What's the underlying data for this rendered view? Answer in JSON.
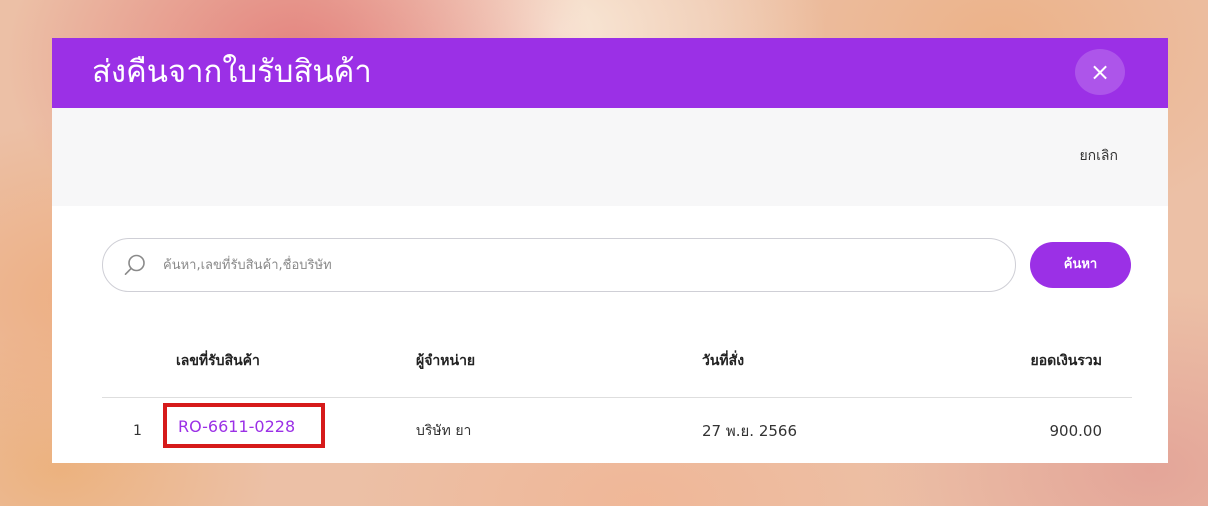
{
  "modal": {
    "title": "ส่งคืนจากใบรับสินค้า",
    "close_icon": "×",
    "cancel_label": "ยกเลิก"
  },
  "search": {
    "placeholder": "ค้นหา,เลขที่รับสินค้า,ชื่อบริษัท",
    "value": "",
    "button_label": "ค้นหา"
  },
  "table": {
    "columns": [
      "เลขที่รับสินค้า",
      "ผู้จำหน่าย",
      "วันที่สั่ง",
      "ยอดเงินรวม"
    ],
    "rows": [
      {
        "index": "1",
        "receipt_no": "RO-6611-0228",
        "supplier": "บริษัท ยา",
        "date": "27 พ.ย. 2566",
        "total": "900.00"
      }
    ]
  },
  "colors": {
    "accent": "#9b30e6",
    "highlight": "#d61a1a"
  },
  "icons": {
    "search": "search-icon",
    "close": "close-icon"
  }
}
